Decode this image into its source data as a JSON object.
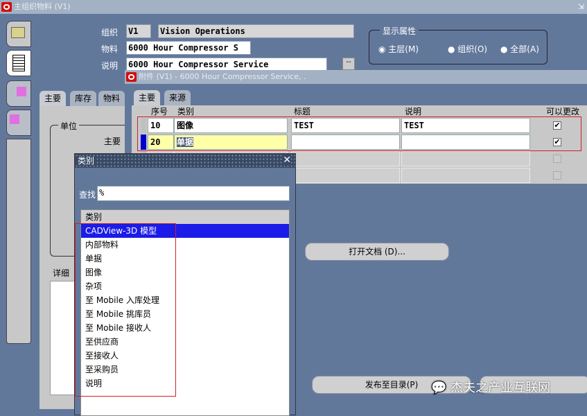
{
  "main_window": {
    "title": "主组织物料 (V1)",
    "org_label": "组织",
    "org_code": "V1",
    "org_name": "Vision Operations",
    "item_label": "物料",
    "item_value": "6000 Hour Compressor S",
    "desc_label": "说明",
    "desc_value": "6000 Hour Compressor Service",
    "desc_button": "--",
    "display_group": {
      "title": "显示属性",
      "options": [
        {
          "label": "主层(M)",
          "selected": true
        },
        {
          "label": "组织(O)",
          "selected": false
        },
        {
          "label": "全部(A)",
          "selected": false
        }
      ]
    },
    "tabs": [
      "主要",
      "库存",
      "物料"
    ],
    "unit_group": "单位",
    "primary_label": "主要",
    "detail_label": "详细"
  },
  "attachments": {
    "title": "附件 (V1) - 6000 Hour Compressor Service, .",
    "tabs": [
      "主要",
      "来源"
    ],
    "columns": [
      "序号",
      "类别",
      "标题",
      "说明",
      "可以更改"
    ],
    "rows": [
      {
        "seq": "10",
        "category": "图像",
        "title": "TEST",
        "description": "TEST",
        "changeable": true
      },
      {
        "seq": "20",
        "category": "单据",
        "title": "",
        "description": "",
        "changeable": true
      },
      {
        "seq": "",
        "category": "",
        "title": "",
        "description": "",
        "changeable": false
      },
      {
        "seq": "",
        "category": "",
        "title": "",
        "description": "",
        "changeable": false
      }
    ],
    "open_doc_button": "打开文档 (D)...",
    "publish_button": "发布至目录(P)"
  },
  "lov": {
    "title": "类别",
    "find_label": "查找",
    "find_value": "%",
    "column": "类别",
    "items": [
      "CADView-3D 模型",
      "内部物料",
      "单据",
      "图像",
      "杂项",
      "至 Mobile 入库处理",
      "至 Mobile 挑库员",
      "至 Mobile 接收人",
      "至供应商",
      "至接收人",
      "至采购员",
      "说明"
    ],
    "selected_index": 0
  },
  "watermark": "杰夫之产业互联网",
  "colors": {
    "background": "#62789b",
    "selection": "#1c1ce8",
    "highlight_row": "#ffffa8",
    "annotation": "#d02020"
  }
}
